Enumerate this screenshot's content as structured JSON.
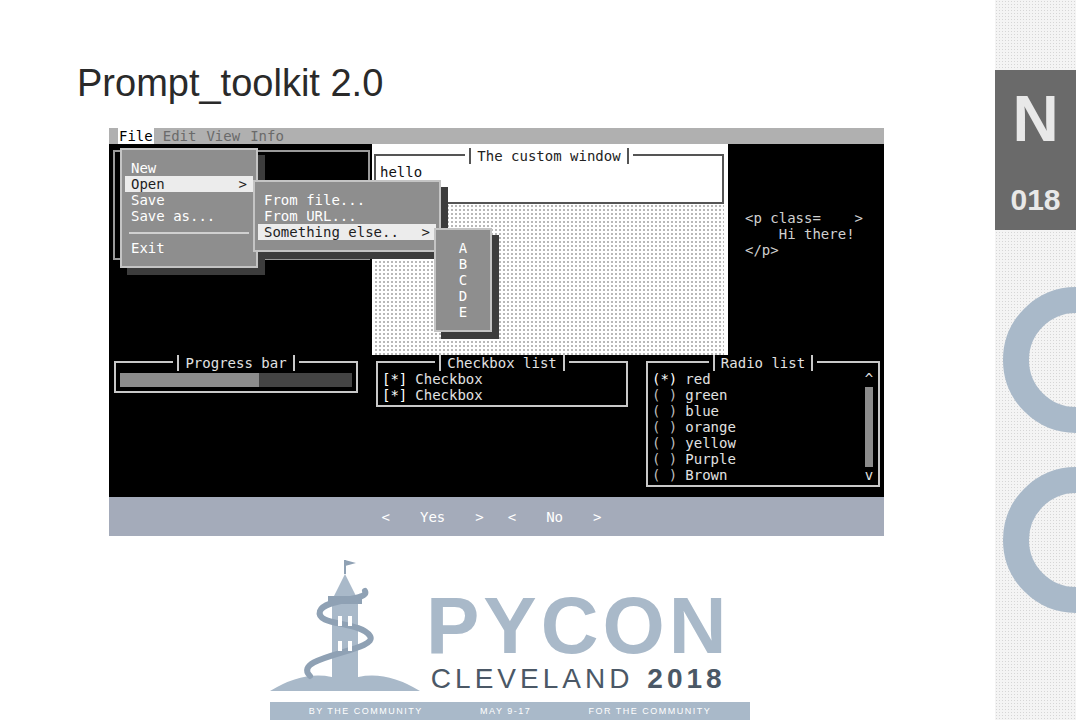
{
  "slide": {
    "title": "Prompt_toolkit 2.0"
  },
  "terminal": {
    "menu_bar": [
      {
        "label": "File",
        "selected": true
      },
      {
        "label": "Edit",
        "selected": false
      },
      {
        "label": "View",
        "selected": false
      },
      {
        "label": "Info",
        "selected": false
      }
    ],
    "file_menu": [
      {
        "kind": "item",
        "label": "New",
        "arrow": "",
        "selected": false
      },
      {
        "kind": "item",
        "label": "Open",
        "arrow": ">",
        "selected": true
      },
      {
        "kind": "item",
        "label": "Save",
        "arrow": "",
        "selected": false
      },
      {
        "kind": "item",
        "label": "Save as...",
        "arrow": "",
        "selected": false
      },
      {
        "kind": "separator",
        "label": "",
        "arrow": "",
        "selected": false
      },
      {
        "kind": "item",
        "label": "Exit",
        "arrow": "",
        "selected": false
      }
    ],
    "open_menu": [
      {
        "kind": "item",
        "label": "From file...",
        "arrow": "",
        "selected": false
      },
      {
        "kind": "item",
        "label": "From URL...",
        "arrow": "",
        "selected": false
      },
      {
        "kind": "item",
        "label": "Something else..",
        "arrow": ">",
        "selected": true
      }
    ],
    "letters_menu": [
      {
        "label": "A",
        "selected": false
      },
      {
        "label": "B",
        "selected": false
      },
      {
        "label": "C",
        "selected": false
      },
      {
        "label": "D",
        "selected": false
      },
      {
        "label": "E",
        "selected": false
      }
    ],
    "custom_window": {
      "title": "The custom window",
      "text": "hello"
    },
    "html_lines": [
      "<p class=    >",
      "    Hi there!",
      "</p>"
    ],
    "progress": {
      "title": "Progress bar",
      "level": 0.6
    },
    "checkbox_list": {
      "title": "Checkbox list",
      "items": [
        {
          "mark": "[*]",
          "label": "Checkbox",
          "checked": true
        },
        {
          "mark": "[*]",
          "label": "Checkbox",
          "checked": true
        }
      ]
    },
    "radio_list": {
      "title": "Radio list",
      "scroll_up": "^",
      "scroll_down": "v",
      "items": [
        {
          "mark": "(*)",
          "label": "red",
          "selected": true
        },
        {
          "mark": "( )",
          "label": "green",
          "selected": false
        },
        {
          "mark": "( )",
          "label": "blue",
          "selected": false
        },
        {
          "mark": "( )",
          "label": "orange",
          "selected": false
        },
        {
          "mark": "( )",
          "label": "yellow",
          "selected": false
        },
        {
          "mark": "( )",
          "label": "Purple",
          "selected": false
        },
        {
          "mark": "( )",
          "label": "Brown",
          "selected": false
        }
      ]
    },
    "buttons": [
      {
        "open": "<",
        "label": "Yes",
        "close": ">",
        "selected": false
      },
      {
        "open": "<",
        "label": "No",
        "close": ">",
        "selected": false
      }
    ]
  },
  "logo": {
    "name": "PYCON",
    "city": "CLEVELAND",
    "year": "2018",
    "tagline": [
      "BY THE COMMUNITY",
      "MAY 9-17",
      "FOR THE COMMUNITY"
    ]
  },
  "side_strip": {
    "texts": [
      "N",
      "018"
    ]
  }
}
